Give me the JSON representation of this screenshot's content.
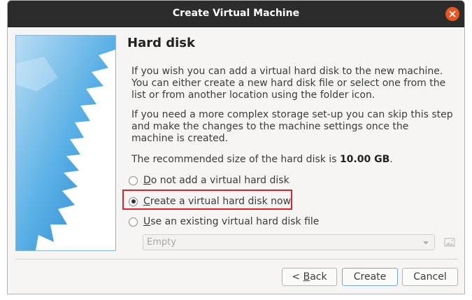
{
  "window": {
    "title": "Create Virtual Machine",
    "close_icon": "close-icon"
  },
  "page": {
    "heading": "Hard disk",
    "paragraph1": "If you wish you can add a virtual hard disk to the new machine. You can either create a new hard disk file or select one from the list or from another location using the folder icon.",
    "paragraph2": "If you need a more complex storage set-up you can skip this step and make the changes to the machine settings once the machine is created.",
    "recommended_prefix": "The recommended size of the hard disk is ",
    "recommended_size": "10.00 GB",
    "recommended_suffix": "."
  },
  "options": [
    {
      "mnemonic": "D",
      "rest": "o not add a virtual hard disk",
      "selected": false
    },
    {
      "mnemonic": "C",
      "rest": "reate a virtual hard disk now",
      "selected": true
    },
    {
      "mnemonic": "U",
      "rest": "se an existing virtual hard disk file",
      "selected": false
    }
  ],
  "existing_disk_combo": {
    "value": "Empty",
    "enabled": false
  },
  "buttons": {
    "back_prefix": "< ",
    "back_mnemonic": "B",
    "back_rest": "ack",
    "create": "Create",
    "cancel": "Cancel"
  },
  "colors": {
    "titlebar": "#2c2c2c",
    "close_button": "#e95420",
    "highlight_box": "#d9232a",
    "wizard_art": "#4aa3df"
  }
}
